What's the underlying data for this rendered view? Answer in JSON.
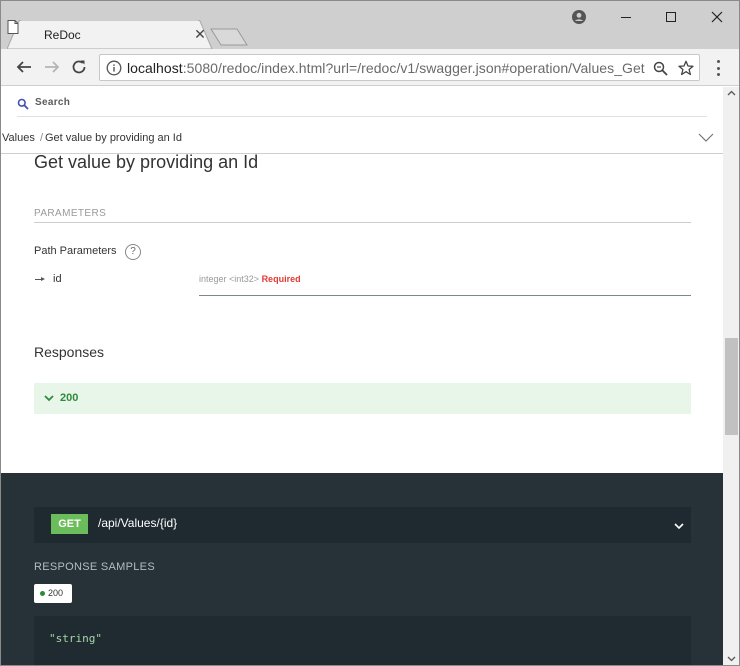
{
  "browser": {
    "tab_title": "ReDoc",
    "url_host": "localhost",
    "url_rest": ":5080/redoc/index.html?url=/redoc/v1/swagger.json#operation/Values_Get"
  },
  "redoc": {
    "search_label": "Search",
    "breadcrumb": {
      "section": "Values",
      "separator": "/",
      "operation": "Get value by providing an Id"
    },
    "operation_title": "Get value by providing an Id",
    "parameters_heading": "PARAMETERS",
    "path_parameters_label": "Path Parameters",
    "help_glyph": "?",
    "param": {
      "name": "id",
      "type": "integer <int32>",
      "required": "Required"
    },
    "responses_title": "Responses",
    "response_code": "200",
    "endpoint": {
      "method": "GET",
      "path": "/api/Values/{id}"
    },
    "samples_title": "RESPONSE SAMPLES",
    "sample_tab": "200",
    "sample_code": "\"string\""
  },
  "colors": {
    "success_green": "#2e8b3d",
    "required_red": "#e53935",
    "dark_panel": "#263238",
    "get_badge": "#6bbd5b"
  }
}
